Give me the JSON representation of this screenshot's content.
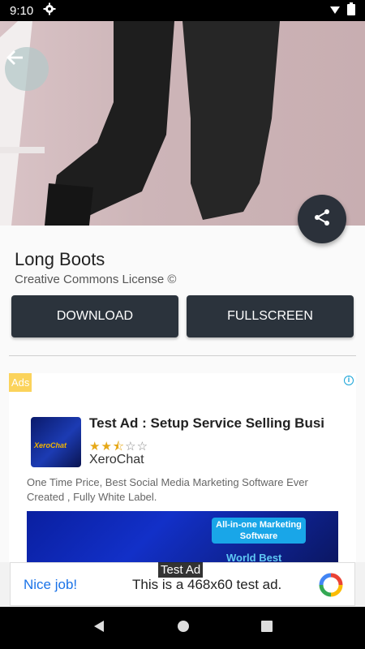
{
  "status_bar": {
    "time": "9:10"
  },
  "photo": {
    "title": "Long Boots",
    "license": "Creative Commons License ©"
  },
  "actions": {
    "download_label": "DOWNLOAD",
    "fullscreen_label": "FULLSCREEN"
  },
  "native_ad": {
    "badge": "Ads",
    "title": "Test Ad : Setup Service Selling Busi",
    "rating_stars": 2.5,
    "advertiser": "XeroChat",
    "icon_brand": "XeroChat",
    "description": "One Time Price, Best Social Media Marketing Software Ever Created , Fully White Label.",
    "banner_pill": "All-in-one Marketing Software",
    "banner_tagline": "World Best"
  },
  "test_banner": {
    "label": "Test Ad",
    "cta": "Nice job!",
    "text": "This is a 468x60 test ad."
  },
  "colors": {
    "primary_button": "#2b333c",
    "ads_badge": "#fbd35b",
    "link_blue": "#1a73e8"
  },
  "icons": [
    "gear-icon",
    "wifi-icon",
    "battery-icon",
    "back-arrow-icon",
    "share-icon",
    "info-icon",
    "back-nav-icon",
    "home-nav-icon",
    "recents-nav-icon"
  ]
}
